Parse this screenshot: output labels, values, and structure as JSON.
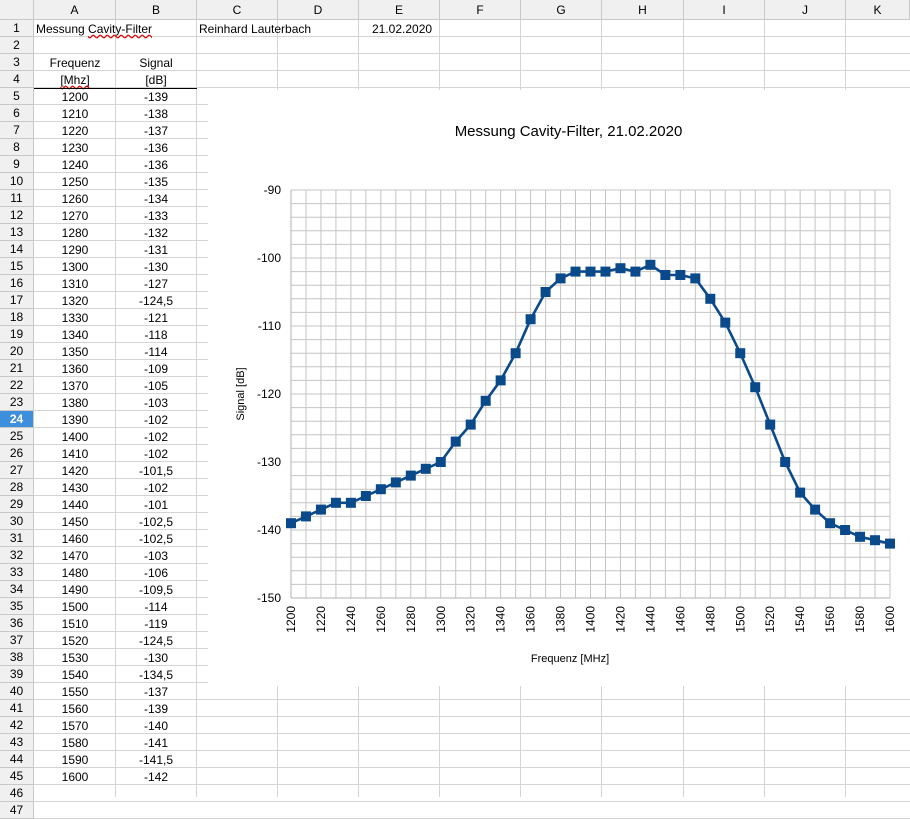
{
  "columns": [
    "A",
    "B",
    "C",
    "D",
    "E",
    "F",
    "G",
    "H",
    "I",
    "J",
    "K"
  ],
  "selected_row": 24,
  "header": {
    "title": "Messung Cavity-Filter",
    "title_word1": "Messung ",
    "title_word2": "Cavity-Filter",
    "author": "Reinhard Lauterbach",
    "date": "21.02.2020"
  },
  "table": {
    "col1_header": "Frequenz",
    "col1_unit": "[Mhz]",
    "col2_header": "Signal",
    "col2_unit": "[dB]",
    "rows": [
      {
        "f": "1200",
        "s": "-139"
      },
      {
        "f": "1210",
        "s": "-138"
      },
      {
        "f": "1220",
        "s": "-137"
      },
      {
        "f": "1230",
        "s": "-136"
      },
      {
        "f": "1240",
        "s": "-136"
      },
      {
        "f": "1250",
        "s": "-135"
      },
      {
        "f": "1260",
        "s": "-134"
      },
      {
        "f": "1270",
        "s": "-133"
      },
      {
        "f": "1280",
        "s": "-132"
      },
      {
        "f": "1290",
        "s": "-131"
      },
      {
        "f": "1300",
        "s": "-130"
      },
      {
        "f": "1310",
        "s": "-127"
      },
      {
        "f": "1320",
        "s": "-124,5"
      },
      {
        "f": "1330",
        "s": "-121"
      },
      {
        "f": "1340",
        "s": "-118"
      },
      {
        "f": "1350",
        "s": "-114"
      },
      {
        "f": "1360",
        "s": "-109"
      },
      {
        "f": "1370",
        "s": "-105"
      },
      {
        "f": "1380",
        "s": "-103"
      },
      {
        "f": "1390",
        "s": "-102"
      },
      {
        "f": "1400",
        "s": "-102"
      },
      {
        "f": "1410",
        "s": "-102"
      },
      {
        "f": "1420",
        "s": "-101,5"
      },
      {
        "f": "1430",
        "s": "-102"
      },
      {
        "f": "1440",
        "s": "-101"
      },
      {
        "f": "1450",
        "s": "-102,5"
      },
      {
        "f": "1460",
        "s": "-102,5"
      },
      {
        "f": "1470",
        "s": "-103"
      },
      {
        "f": "1480",
        "s": "-106"
      },
      {
        "f": "1490",
        "s": "-109,5"
      },
      {
        "f": "1500",
        "s": "-114"
      },
      {
        "f": "1510",
        "s": "-119"
      },
      {
        "f": "1520",
        "s": "-124,5"
      },
      {
        "f": "1530",
        "s": "-130"
      },
      {
        "f": "1540",
        "s": "-134,5"
      },
      {
        "f": "1550",
        "s": "-137"
      },
      {
        "f": "1560",
        "s": "-139"
      },
      {
        "f": "1570",
        "s": "-140"
      },
      {
        "f": "1580",
        "s": "-141"
      },
      {
        "f": "1590",
        "s": "-141,5"
      },
      {
        "f": "1600",
        "s": "-142"
      }
    ]
  },
  "chart_data": {
    "type": "line",
    "title": "Messung Cavity-Filter, 21.02.2020",
    "xlabel": "Frequenz [MHz]",
    "ylabel": "Signal [dB]",
    "xlim": [
      1200,
      1600
    ],
    "ylim": [
      -150,
      -90
    ],
    "x_ticks": [
      1200,
      1220,
      1240,
      1260,
      1280,
      1300,
      1320,
      1340,
      1360,
      1380,
      1400,
      1420,
      1440,
      1460,
      1480,
      1500,
      1520,
      1540,
      1560,
      1580,
      1600
    ],
    "y_ticks": [
      -90,
      -100,
      -110,
      -120,
      -130,
      -140,
      -150
    ],
    "grid": true,
    "line_color": "#0b4a8a",
    "marker": "square",
    "x": [
      1200,
      1210,
      1220,
      1230,
      1240,
      1250,
      1260,
      1270,
      1280,
      1290,
      1300,
      1310,
      1320,
      1330,
      1340,
      1350,
      1360,
      1370,
      1380,
      1390,
      1400,
      1410,
      1420,
      1430,
      1440,
      1450,
      1460,
      1470,
      1480,
      1490,
      1500,
      1510,
      1520,
      1530,
      1540,
      1550,
      1560,
      1570,
      1580,
      1590,
      1600
    ],
    "y": [
      -139,
      -138,
      -137,
      -136,
      -136,
      -135,
      -134,
      -133,
      -132,
      -131,
      -130,
      -127,
      -124.5,
      -121,
      -118,
      -114,
      -109,
      -105,
      -103,
      -102,
      -102,
      -102,
      -101.5,
      -102,
      -101,
      -102.5,
      -102.5,
      -103,
      -106,
      -109.5,
      -114,
      -119,
      -124.5,
      -130,
      -134.5,
      -137,
      -139,
      -140,
      -141,
      -141.5,
      -142
    ]
  }
}
